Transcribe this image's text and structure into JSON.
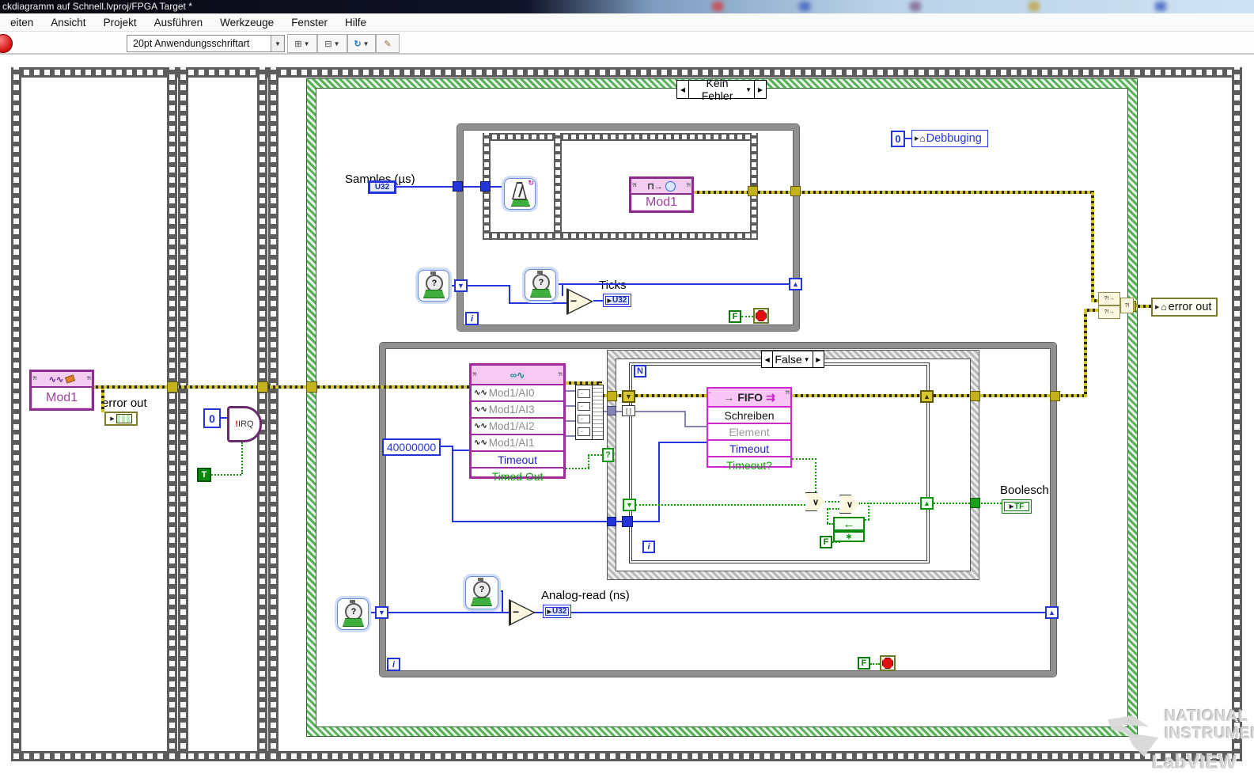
{
  "window": {
    "title": "ckdiagramm auf Schnell.lvproj/FPGA Target *"
  },
  "menu": {
    "items": [
      "eiten",
      "Ansicht",
      "Projekt",
      "Ausführen",
      "Werkzeuge",
      "Fenster",
      "Hilfe"
    ]
  },
  "toolbar": {
    "font_selector": "20pt Anwendungsschriftart"
  },
  "icons": {
    "dropdown": "▼",
    "align": "⊞",
    "distribute": "⊟",
    "reorder": "↻",
    "cleanup": "✎"
  },
  "glyphs": {
    "case_left": "◀",
    "case_right": "▶",
    "err_corner": "?!",
    "doc": "▫",
    "arrow_out": "▶",
    "house": "⌂",
    "sr_down": "▼",
    "sr_up": "▲",
    "selector": "?",
    "or": "∨",
    "feedback": "←",
    "init": "∗",
    "minus": "−",
    "wave": "∿∿",
    "seq_icon": "⊓→",
    "glasses": "∞∿",
    "fifo_in": "→",
    "fifo_out": "⇉",
    "merge_in": "?!→",
    "merge_out": "?!",
    "index": "[ ]"
  },
  "constants": {
    "irq_zero": "0",
    "debug_zero": "0",
    "timeout": "40000000",
    "t_const": "T",
    "f_const": "F",
    "n_term": "N",
    "i_term": "i"
  },
  "terminals": {
    "u32": "U32",
    "tf": "TF"
  },
  "nodes": {
    "mod1_clear": {
      "label": "Mod1"
    },
    "mod1_seq": {
      "label": "Mod1"
    },
    "irq": {
      "bang": "!",
      "label": "IRQ"
    },
    "ai": {
      "rows": [
        "Mod1/AI0",
        "Mod1/AI3",
        "Mod1/AI2",
        "Mod1/AI1"
      ],
      "timeout": "Timeout",
      "timed_out": "Timed Out"
    },
    "fifo": {
      "title": "FIFO",
      "method": "Schreiben",
      "element": "Element",
      "timeout": "Timeout",
      "timeout_q": "Timeout?"
    }
  },
  "labels": {
    "samples": "Samples (µs)",
    "ticks": "Ticks",
    "debugging": "Debbuging",
    "error_out_left": "error out",
    "error_out_right": "error out",
    "analog_read": "Analog-read (ns)",
    "boolesch": "Boolesch",
    "case_main": "Kein Fehler",
    "case_inner": "False"
  },
  "watermark": {
    "line1": "NATIONAL",
    "line2": "INSTRUMENTS",
    "line3": "LabVIEW"
  }
}
